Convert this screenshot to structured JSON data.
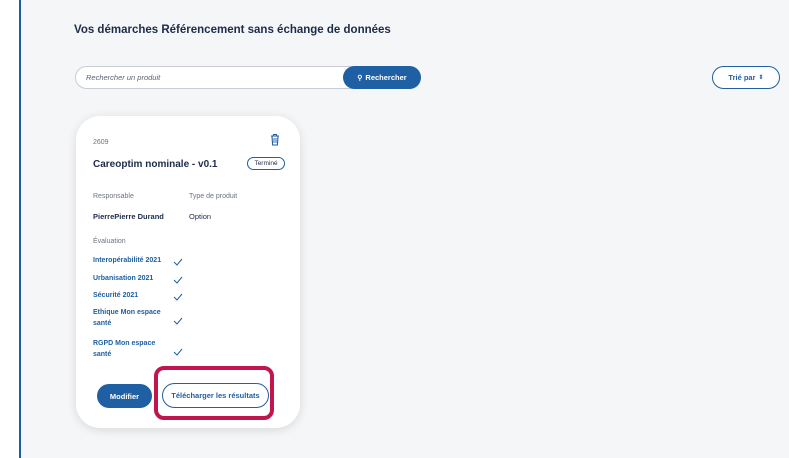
{
  "page": {
    "title": "Vos démarches Référencement sans échange de données"
  },
  "search": {
    "placeholder": "Rechercher un produit",
    "button_label": "Rechercher"
  },
  "sort": {
    "label": "Trié par"
  },
  "card": {
    "id": "2609",
    "title": "Careoptim nominale - v0.1",
    "status": "Terminé",
    "responsable_label": "Responsable",
    "responsable_value": "PierrePierre Durand",
    "type_label": "Type de produit",
    "type_value": "Option",
    "evaluation_label": "Évaluation",
    "evaluations": [
      {
        "line1": "Interopérabilité 2021",
        "line2": ""
      },
      {
        "line1": "Urbanisation 2021",
        "line2": ""
      },
      {
        "line1": "Sécurité 2021",
        "line2": ""
      },
      {
        "line1": "Ethique Mon espace",
        "line2": "santé"
      },
      {
        "line1": "RGPD Mon espace",
        "line2": "santé"
      }
    ],
    "modify_label": "Modifier",
    "download_label": "Télécharger les résultats"
  },
  "colors": {
    "primary": "#1f5fa3",
    "highlight": "#c0164d",
    "text": "#1d2b4a"
  }
}
